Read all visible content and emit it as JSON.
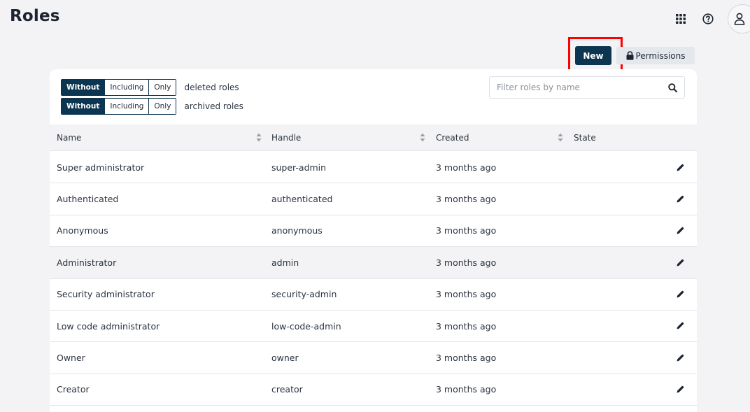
{
  "header": {
    "title": "Roles",
    "icons": [
      "apps-grid-icon",
      "help-circle-icon",
      "user-icon"
    ]
  },
  "toolbar": {
    "new_label": "New",
    "permissions_label": "Permissions",
    "permissions_icon": "lock-icon"
  },
  "filters": {
    "deleted": {
      "options": [
        "Without",
        "Including",
        "Only"
      ],
      "selected": "Without",
      "label": "deleted roles"
    },
    "archived": {
      "options": [
        "Without",
        "Including",
        "Only"
      ],
      "selected": "Without",
      "label": "archived roles"
    }
  },
  "search": {
    "placeholder": "Filter roles by name",
    "value": ""
  },
  "table": {
    "columns": [
      "Name",
      "Handle",
      "Created",
      "State"
    ],
    "rows": [
      {
        "name": "Super administrator",
        "handle": "super-admin",
        "created": "3 months ago",
        "state": ""
      },
      {
        "name": "Authenticated",
        "handle": "authenticated",
        "created": "3 months ago",
        "state": ""
      },
      {
        "name": "Anonymous",
        "handle": "anonymous",
        "created": "3 months ago",
        "state": ""
      },
      {
        "name": "Administrator",
        "handle": "admin",
        "created": "3 months ago",
        "state": ""
      },
      {
        "name": "Security administrator",
        "handle": "security-admin",
        "created": "3 months ago",
        "state": ""
      },
      {
        "name": "Low code administrator",
        "handle": "low-code-admin",
        "created": "3 months ago",
        "state": ""
      },
      {
        "name": "Owner",
        "handle": "owner",
        "created": "3 months ago",
        "state": ""
      },
      {
        "name": "Creator",
        "handle": "creator",
        "created": "3 months ago",
        "state": ""
      }
    ]
  },
  "colors": {
    "primary": "#0b3550",
    "background": "#f3f3f5",
    "highlight": "#ff0000"
  }
}
